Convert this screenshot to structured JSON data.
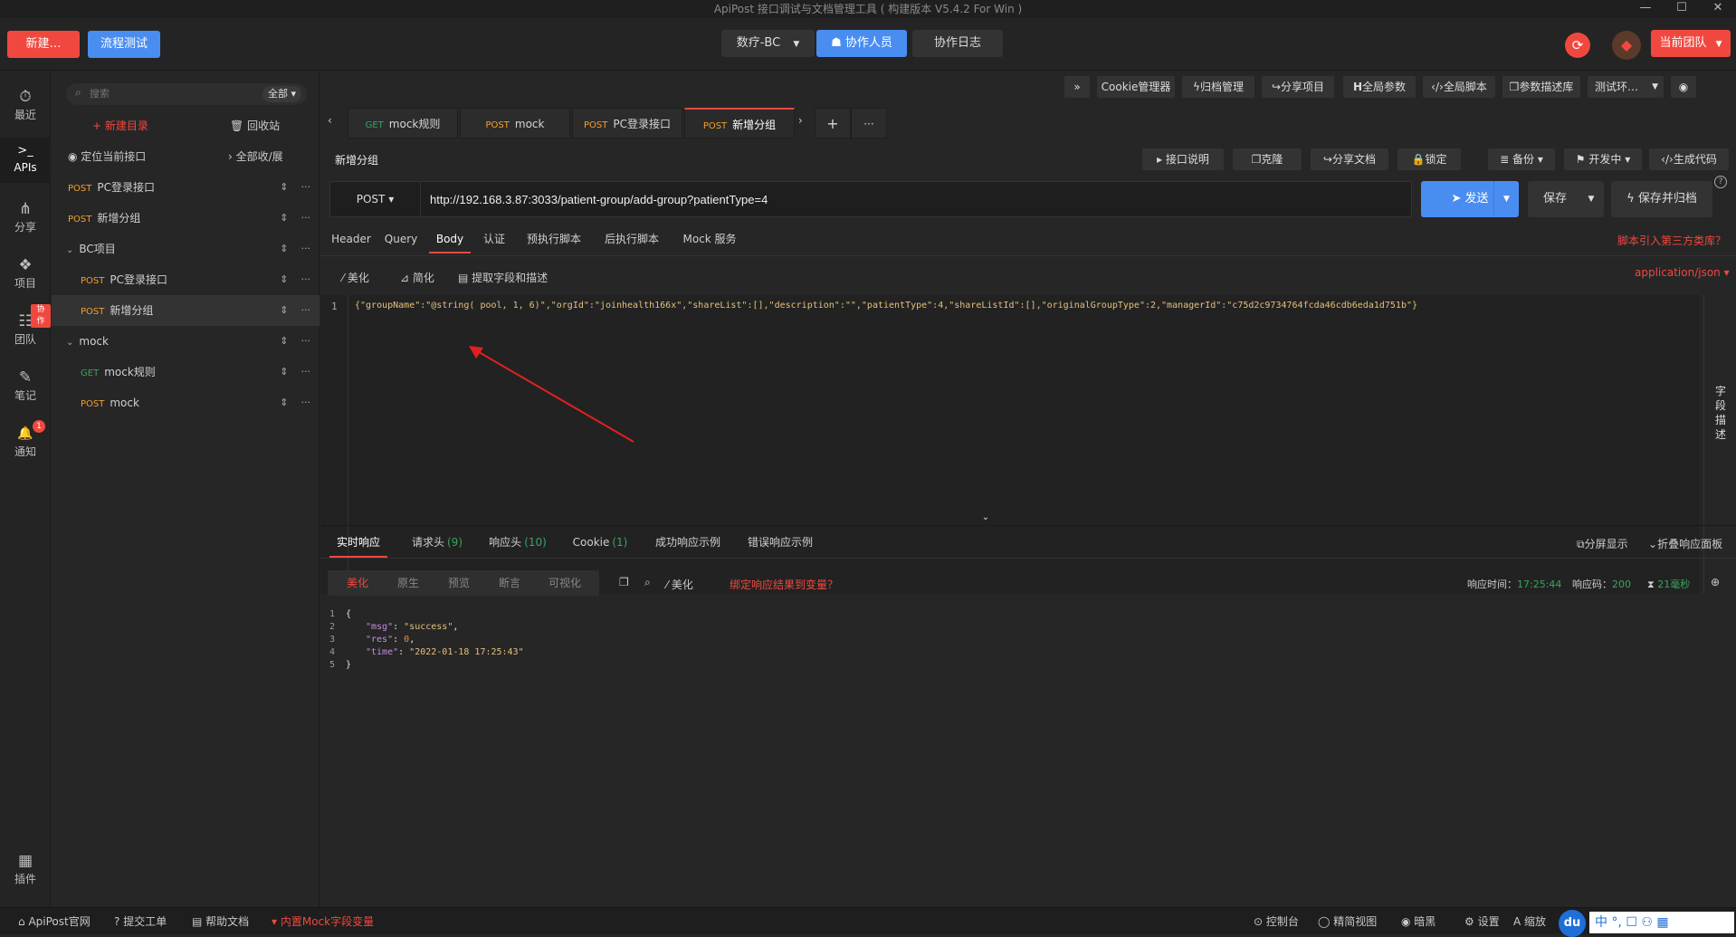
{
  "window": {
    "title": "ApiPost 接口调试与文档管理工具 ( 构建版本 V5.4.2 For Win )",
    "min": "—",
    "max": "☐",
    "close": "✕"
  },
  "topbar": {
    "new_btn": "新建…",
    "flow_btn": "流程测试",
    "project_select": "数疗-BC",
    "collab_btn": "协作人员",
    "log_btn": "协作日志",
    "team_btn": "当前团队"
  },
  "leftnav": [
    {
      "icon": "⏱",
      "label": "最近"
    },
    {
      "icon": ">_",
      "label": "APIs"
    },
    {
      "icon": "⋔",
      "label": "分享"
    },
    {
      "icon": "❖",
      "label": "项目"
    },
    {
      "icon": "☷",
      "label": "团队",
      "badge": "协作"
    },
    {
      "icon": "✎",
      "label": "笔记"
    },
    {
      "icon": "🔔",
      "label": "通知",
      "badge": "1"
    },
    {
      "icon": "▦",
      "label": "插件"
    }
  ],
  "sidebar": {
    "search_placeholder": "搜索",
    "filter": "全部",
    "new_dir": "+ 新建目录",
    "recycle": "回收站",
    "locate": "定位当前接口",
    "collapse": "全部收/展",
    "tree": [
      {
        "method": "POST",
        "label": "PC登录接口",
        "indent": 0
      },
      {
        "method": "POST",
        "label": "新增分组",
        "indent": 0
      },
      {
        "method": "",
        "label": "BC项目",
        "indent": 0,
        "folder": true
      },
      {
        "method": "POST",
        "label": "PC登录接口",
        "indent": 1
      },
      {
        "method": "POST",
        "label": "新增分组",
        "indent": 1,
        "selected": true
      },
      {
        "method": "",
        "label": "mock",
        "indent": 0,
        "folder": true
      },
      {
        "method": "GET",
        "label": "mock规则",
        "indent": 1
      },
      {
        "method": "POST",
        "label": "mock",
        "indent": 1
      }
    ]
  },
  "toolbar_top": {
    "more": "»",
    "cookie": "Cookie管理器",
    "archive": "归档管理",
    "share": "分享项目",
    "globals": "全局参数",
    "script": "全局脚本",
    "paramlib": "参数描述库",
    "env": "测试环…"
  },
  "tabs": [
    {
      "method": "GET",
      "label": "mock规则"
    },
    {
      "method": "POST",
      "label": "mock"
    },
    {
      "method": "POST",
      "label": "PC登录接口"
    },
    {
      "method": "POST",
      "label": "新增分组",
      "active": true
    }
  ],
  "request": {
    "name": "新增分组",
    "actions": {
      "doc": "接口说明",
      "clone": "克隆",
      "share": "分享文档",
      "lock": "锁定",
      "backup": "备份",
      "status": "开发中",
      "codegen": "生成代码"
    },
    "method": "POST",
    "url": "http://192.168.3.87:3033/patient-group/add-group?patientType=4",
    "send": "发送",
    "save": "保存",
    "save_archive": "保存并归档",
    "subtabs": [
      "Header",
      "Query",
      "Body",
      "认证",
      "预执行脚本",
      "后执行脚本",
      "Mock 服务"
    ],
    "script_link": "脚本引入第三方类库？",
    "content_type": "application/json",
    "body_tools": {
      "beautify": "美化",
      "simplify": "简化",
      "extract": "提取字段和描述"
    },
    "body_code": "{\"groupName\":\"@string( pool, 1, 6)\",\"orgId\":\"joinhealth166x\",\"shareList\":[],\"description\":\"\",\"patientType\":4,\"shareListId\":[],\"originalGroupType\":2,\"managerId\":\"c75d2c9734764fcda46cdb6eda1d751b\"}",
    "field_desc": "字段描述"
  },
  "response": {
    "tabs": [
      {
        "label": "实时响应"
      },
      {
        "label": "请求头",
        "count": "(9)"
      },
      {
        "label": "响应头",
        "count": "(10)"
      },
      {
        "label": "Cookie",
        "count": "(1)"
      },
      {
        "label": "成功响应示例"
      },
      {
        "label": "错误响应示例"
      }
    ],
    "split": "分屏显示",
    "fold": "折叠响应面板",
    "view_modes": [
      "美化",
      "原生",
      "预览",
      "断言",
      "可视化"
    ],
    "beautify": "美化",
    "bind_var": "绑定响应结果到变量？",
    "time_label": "响应时间：",
    "time": "17:25:44",
    "code_label": "响应码：",
    "code": "200",
    "duration": "21毫秒",
    "lines": [
      {
        "n": "1",
        "text": "{"
      },
      {
        "n": "2",
        "key": "\"msg\"",
        "val": "\"success\"",
        "type": "str"
      },
      {
        "n": "3",
        "key": "\"res\"",
        "val": "0",
        "type": "num"
      },
      {
        "n": "4",
        "key": "\"time\"",
        "val": "\"2022-01-18 17:25:43\"",
        "type": "str"
      },
      {
        "n": "5",
        "text": "}"
      }
    ]
  },
  "footer": {
    "site": "ApiPost官网",
    "ticket": "提交工单",
    "help": "帮助文档",
    "mock": "内置Mock字段变量",
    "console": "控制台",
    "compact": "精简视图",
    "dark": "暗黑",
    "settings": "设置",
    "zoom": "缩放"
  },
  "colors": {
    "accent": "#f0483e",
    "blue": "#4a8df0",
    "post": "#f59f2b",
    "get": "#3aa55d"
  }
}
